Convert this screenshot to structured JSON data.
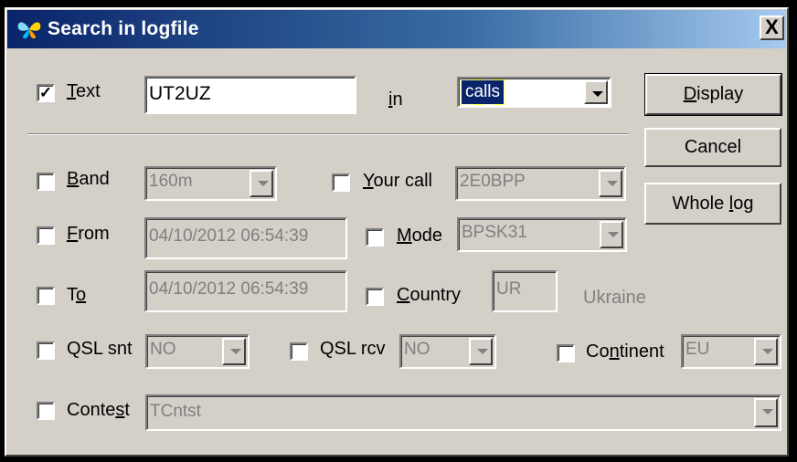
{
  "window": {
    "title": "Search in logfile",
    "close_label": "X"
  },
  "text_row": {
    "checked": true,
    "label": "Text",
    "value": "UT2UZ",
    "in_label": "in",
    "in_selected": "calls"
  },
  "buttons": {
    "display": "Display",
    "cancel": "Cancel",
    "whole_log": "Whole log"
  },
  "band": {
    "label": "Band",
    "value": "160m"
  },
  "your_call": {
    "label": "Your call",
    "value": "2E0BPP"
  },
  "from": {
    "label": "From",
    "value": "04/10/2012 06:54:39"
  },
  "mode": {
    "label": "Mode",
    "value": "BPSK31"
  },
  "to": {
    "label": "To",
    "value": "04/10/2012 06:54:39"
  },
  "country": {
    "label": "Country",
    "value": "UR",
    "name": "Ukraine"
  },
  "qsl_snt": {
    "label": "QSL snt",
    "value": "NO"
  },
  "qsl_rcv": {
    "label": "QSL rcv",
    "value": "NO"
  },
  "continent": {
    "label": "Continent",
    "value": "EU"
  },
  "contest": {
    "label": "Contest",
    "value": "TCntst"
  },
  "colors": {
    "title_start": "#0a246a",
    "title_end": "#a6caf0",
    "face": "#d4d0c8",
    "selection": "#0a246a"
  }
}
